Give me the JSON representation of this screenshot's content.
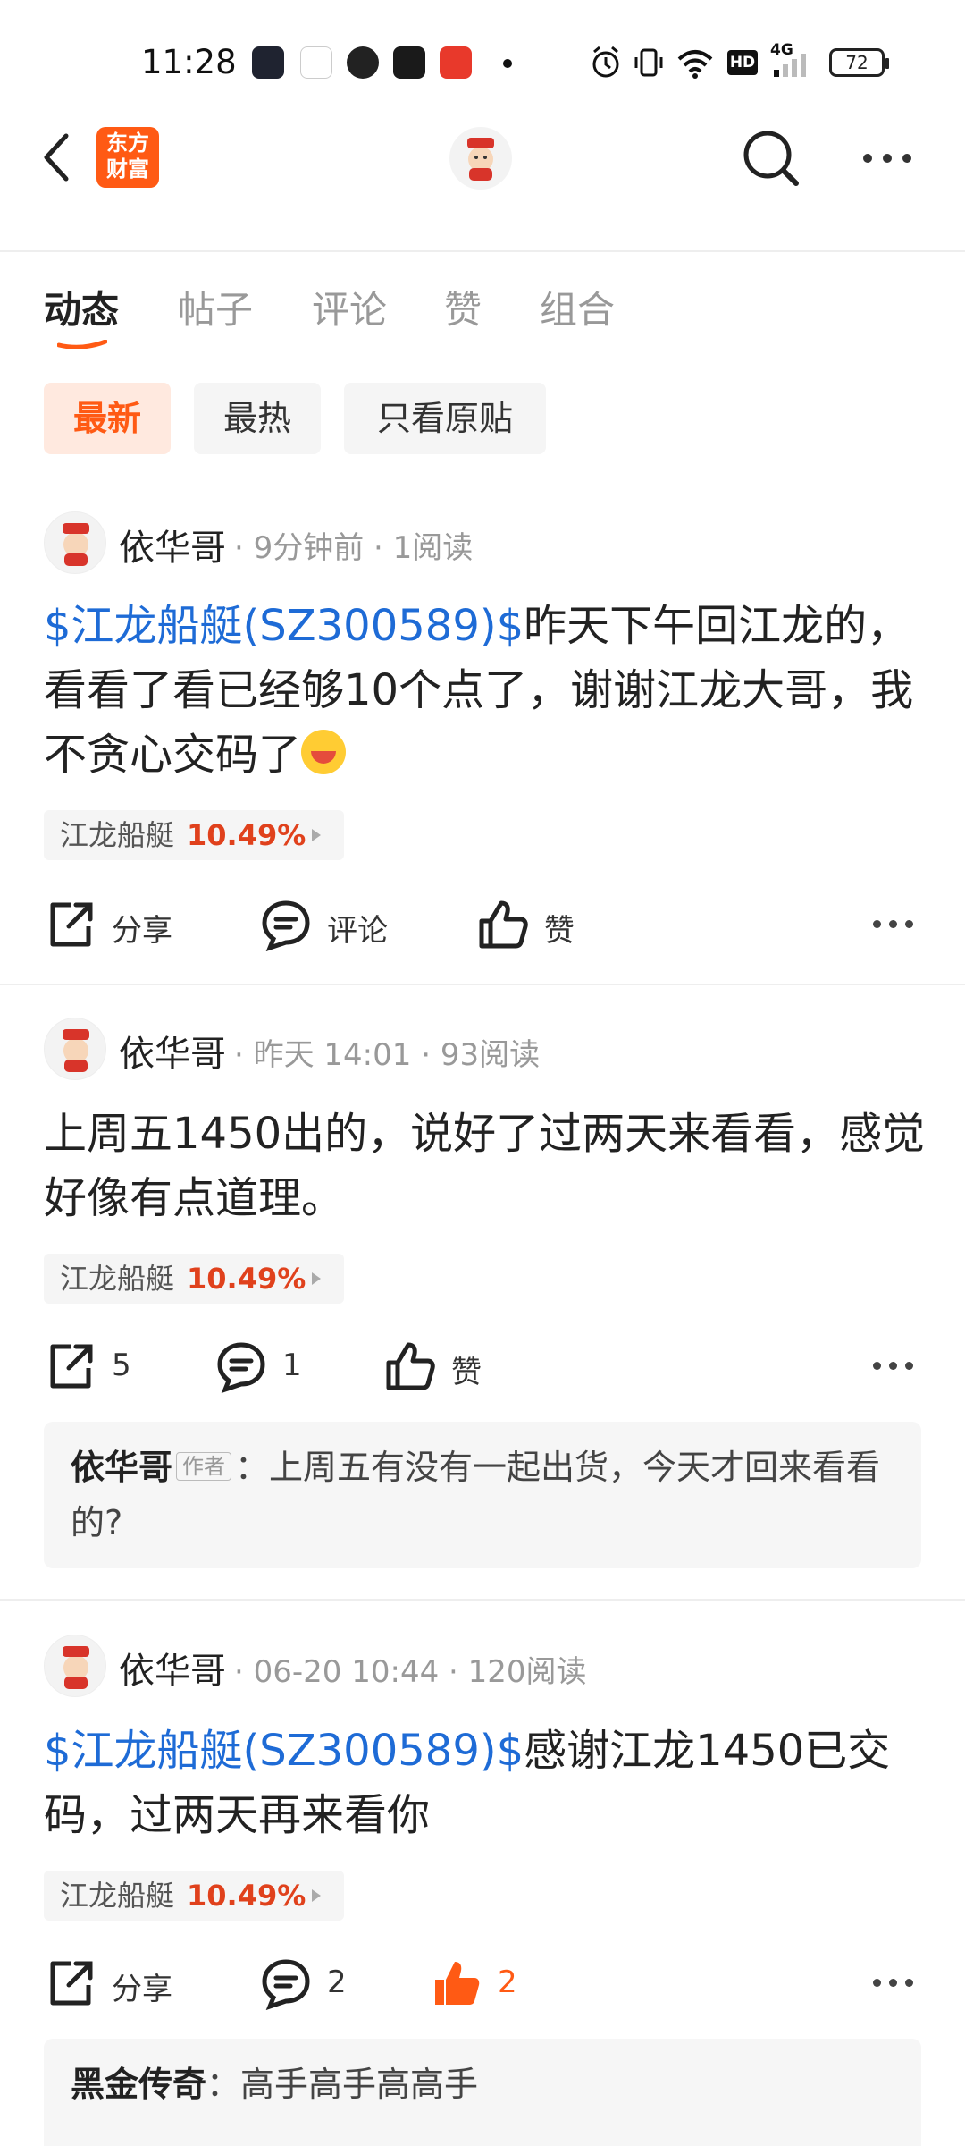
{
  "status_bar": {
    "time": "11:28",
    "battery": "72",
    "network": "4G",
    "hd": "HD"
  },
  "header": {
    "logo_line1": "东方",
    "logo_line2": "财富"
  },
  "tabs": [
    {
      "label": "动态",
      "active": true
    },
    {
      "label": "帖子",
      "active": false
    },
    {
      "label": "评论",
      "active": false
    },
    {
      "label": "赞",
      "active": false
    },
    {
      "label": "组合",
      "active": false
    }
  ],
  "filters": [
    {
      "label": "最新",
      "active": true
    },
    {
      "label": "最热",
      "active": false
    },
    {
      "label": "只看原贴",
      "active": false
    }
  ],
  "posts": [
    {
      "user": "依华哥",
      "meta": "· 9分钟前 · 1阅读",
      "link": "$江龙船艇(SZ300589)$",
      "text": "昨天下午回江龙的，看看了看已经够10个点了，谢谢江龙大哥，我不贪心交码了",
      "stock": {
        "name": "江龙船艇",
        "change": "10.49%"
      },
      "actions": {
        "share": "分享",
        "comment": "评论",
        "like": "赞"
      }
    },
    {
      "user": "依华哥",
      "meta": "· 昨天 14:01 · 93阅读",
      "link": "",
      "text": "上周五1450出的，说好了过两天来看看，感觉好像有点道理。",
      "stock": {
        "name": "江龙船艇",
        "change": "10.49%"
      },
      "actions": {
        "share": "5",
        "comment": "1",
        "like": "赞"
      },
      "reply": {
        "author": "依华哥",
        "badge": "作者",
        "text": "：上周五有没有一起出货，今天才回来看看的?"
      }
    },
    {
      "user": "依华哥",
      "meta": "· 06-20 10:44 · 120阅读",
      "link": "$江龙船艇(SZ300589)$",
      "text": "感谢江龙1450已交码，过两天再来看你",
      "stock": {
        "name": "江龙船艇",
        "change": "10.49%"
      },
      "actions": {
        "share": "分享",
        "comment": "2",
        "like": "2"
      },
      "reply": {
        "author": "黑金传奇",
        "text": "：高手高手高高手"
      }
    }
  ],
  "colors": {
    "accent": "#ff5a14",
    "link": "#1e6bd6",
    "stock_up": "#e0411c"
  }
}
